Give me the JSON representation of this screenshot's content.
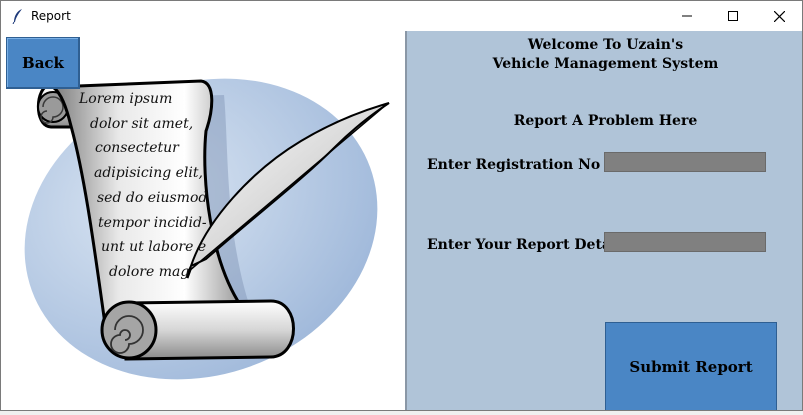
{
  "window": {
    "title": "Report",
    "controls": {
      "minimize": "minimize",
      "maximize": "maximize",
      "close": "close"
    }
  },
  "left": {
    "back_label": "Back",
    "illustration": {
      "name": "scroll-and-quill",
      "lines": [
        "Lorem ipsum",
        "dolor sit amet,",
        "consectetur",
        "adipisicing elit,",
        "sed do eiusmod",
        "tempor incidid-",
        "unt ut labore e",
        "dolore mag"
      ]
    }
  },
  "right": {
    "welcome_line1": "Welcome To Uzain's",
    "welcome_line2": "Vehicle Management System",
    "heading": "Report A Problem Here",
    "registration_label": "Enter Registration No",
    "registration_value": "",
    "details_label": "Enter Your Report Details",
    "details_value": "",
    "submit_label": "Submit Report"
  },
  "colors": {
    "button_blue": "#4a86c5",
    "panel_bg": "#b0c4d8",
    "field_gray": "#808080"
  }
}
